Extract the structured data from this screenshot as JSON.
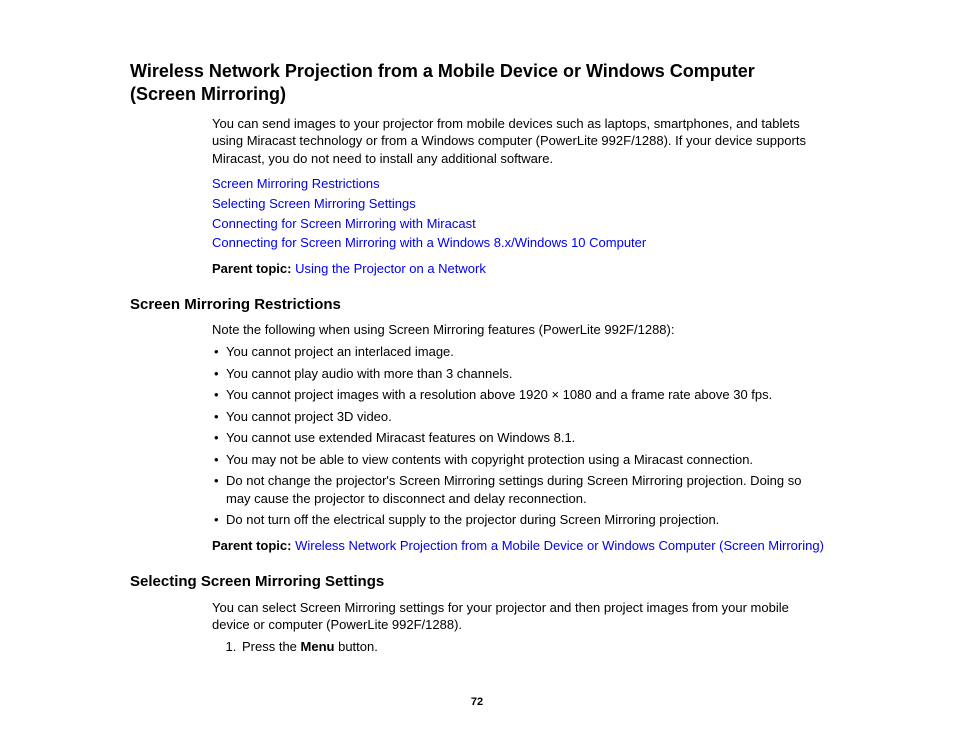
{
  "title": "Wireless Network Projection from a Mobile Device or Windows Computer (Screen Mirroring)",
  "intro": "You can send images to your projector from mobile devices such as laptops, smartphones, and tablets using Miracast technology or from a Windows computer (PowerLite 992F/1288). If your device supports Miracast, you do not need to install any additional software.",
  "links": {
    "a": "Screen Mirroring Restrictions",
    "b": "Selecting Screen Mirroring Settings",
    "c": "Connecting for Screen Mirroring with Miracast",
    "d": "Connecting for Screen Mirroring with a Windows 8.x/Windows 10 Computer"
  },
  "parent_topic_label": "Parent topic:",
  "parent_topic_main": "Using the Projector on a Network",
  "section1": {
    "heading": "Screen Mirroring Restrictions",
    "intro": "Note the following when using Screen Mirroring features (PowerLite 992F/1288):",
    "items": {
      "a": "You cannot project an interlaced image.",
      "b": "You cannot play audio with more than 3 channels.",
      "c": "You cannot project images with a resolution above 1920 × 1080 and a frame rate above 30 fps.",
      "d": "You cannot project 3D video.",
      "e": "You cannot use extended Miracast features on Windows 8.1.",
      "f": "You may not be able to view contents with copyright protection using a Miracast connection.",
      "g": "Do not change the projector's Screen Mirroring settings during Screen Mirroring projection. Doing so may cause the projector to disconnect and delay reconnection.",
      "h": "Do not turn off the electrical supply to the projector during Screen Mirroring projection."
    },
    "parent_link": "Wireless Network Projection from a Mobile Device or Windows Computer (Screen Mirroring)"
  },
  "section2": {
    "heading": "Selecting Screen Mirroring Settings",
    "intro": "You can select Screen Mirroring settings for your projector and then project images from your mobile device or computer (PowerLite 992F/1288).",
    "step1_prefix": "Press the ",
    "step1_bold": "Menu",
    "step1_suffix": " button."
  },
  "page_number": "72"
}
